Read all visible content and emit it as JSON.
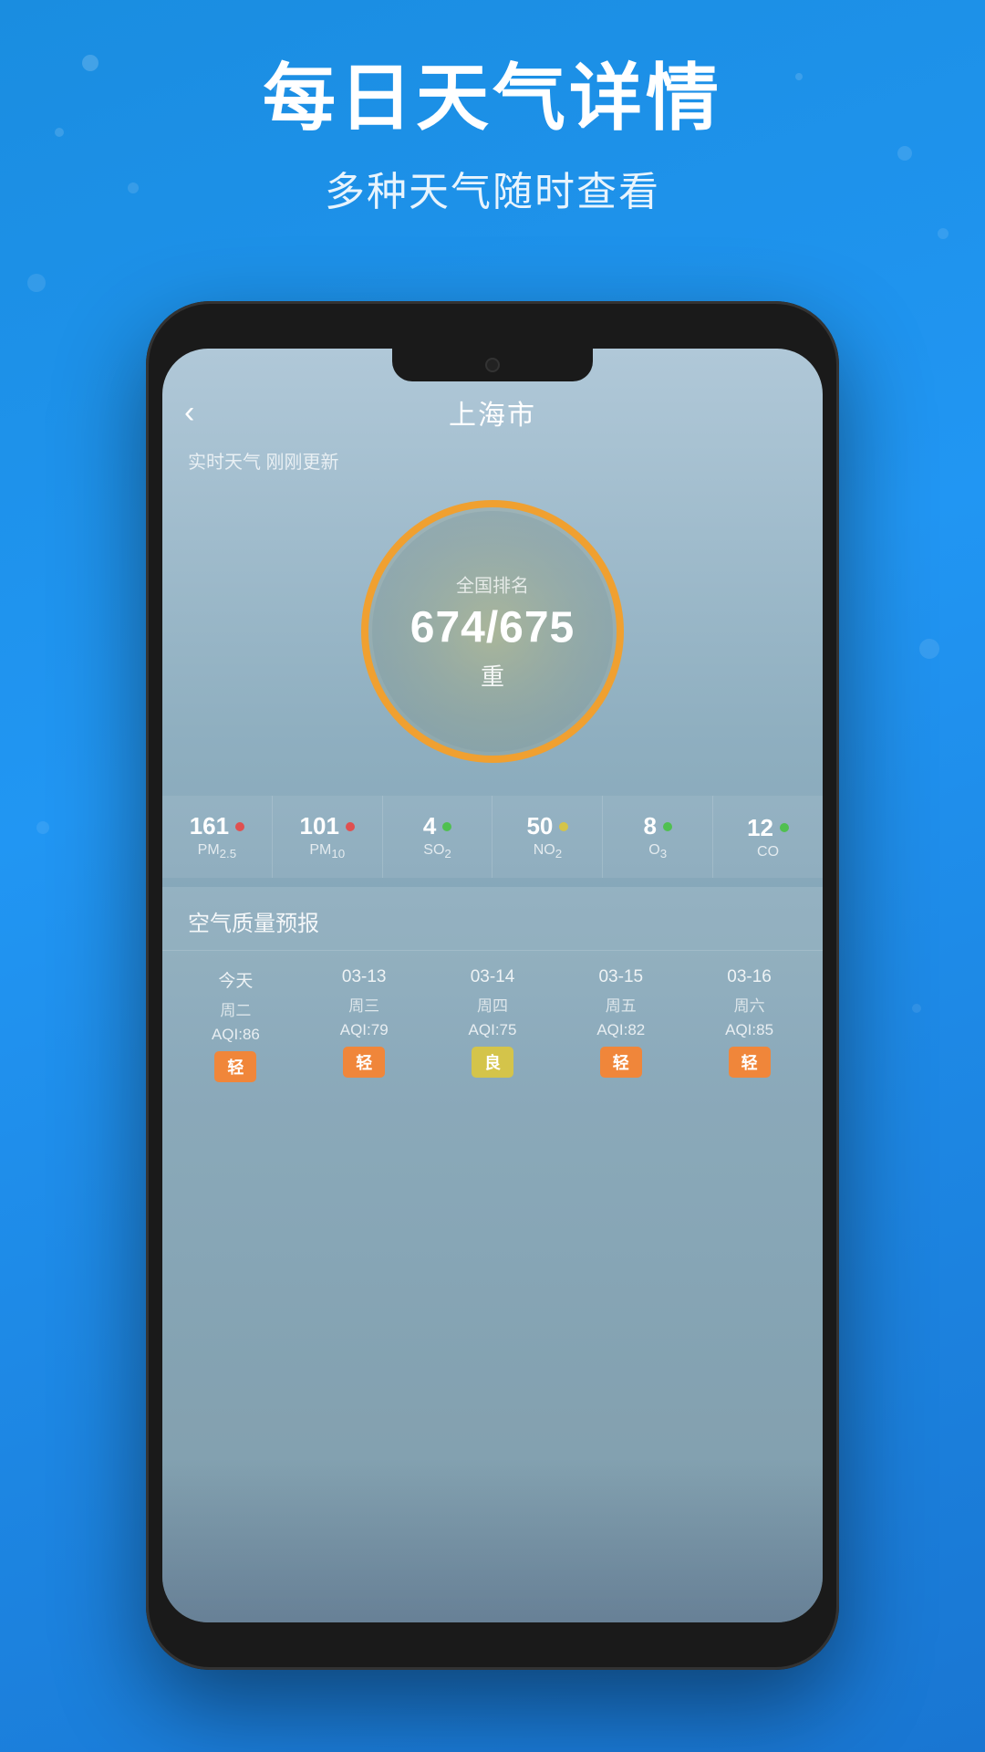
{
  "background": {
    "color": "#2196f3"
  },
  "header": {
    "main_title": "每日天气详情",
    "sub_title": "多种天气随时查看"
  },
  "app": {
    "back_label": "‹",
    "city_name": "上海市",
    "update_info": "实时天气 刚刚更新",
    "aqi": {
      "rank_label": "全国排名",
      "rank_value": "674/675",
      "rank_desc": "重"
    },
    "pollutants": [
      {
        "value": "161",
        "name": "PM₂.₅",
        "dot_color": "#e05050",
        "name_sub": "PM2.5"
      },
      {
        "value": "101",
        "name": "PM₁₀",
        "dot_color": "#e05050",
        "name_sub": "PM10"
      },
      {
        "value": "4",
        "name": "SO₂",
        "dot_color": "#50c050",
        "name_sub": "SO2"
      },
      {
        "value": "50",
        "name": "NO₂",
        "dot_color": "#d4c44a",
        "name_sub": "NO2"
      },
      {
        "value": "8",
        "name": "O₃",
        "dot_color": "#50c050",
        "name_sub": "O3"
      },
      {
        "value": "12",
        "name": "CO",
        "dot_color": "#50c050",
        "name_sub": "CO"
      }
    ],
    "forecast": {
      "section_title": "空气质量预报",
      "items": [
        {
          "date": "今天",
          "weekday": "周二",
          "aqi": "AQI:86",
          "badge": "轻",
          "badge_type": "orange"
        },
        {
          "date": "03-13",
          "weekday": "周三",
          "aqi": "AQI:79",
          "badge": "轻",
          "badge_type": "orange"
        },
        {
          "date": "03-14",
          "weekday": "周四",
          "aqi": "AQI:75",
          "badge": "良",
          "badge_type": "yellow"
        },
        {
          "date": "03-15",
          "weekday": "周五",
          "aqi": "AQI:82",
          "badge": "轻",
          "badge_type": "orange"
        },
        {
          "date": "03-16",
          "weekday": "周六",
          "aqi": "AQI:85",
          "badge": "轻",
          "badge_type": "orange"
        }
      ]
    }
  }
}
